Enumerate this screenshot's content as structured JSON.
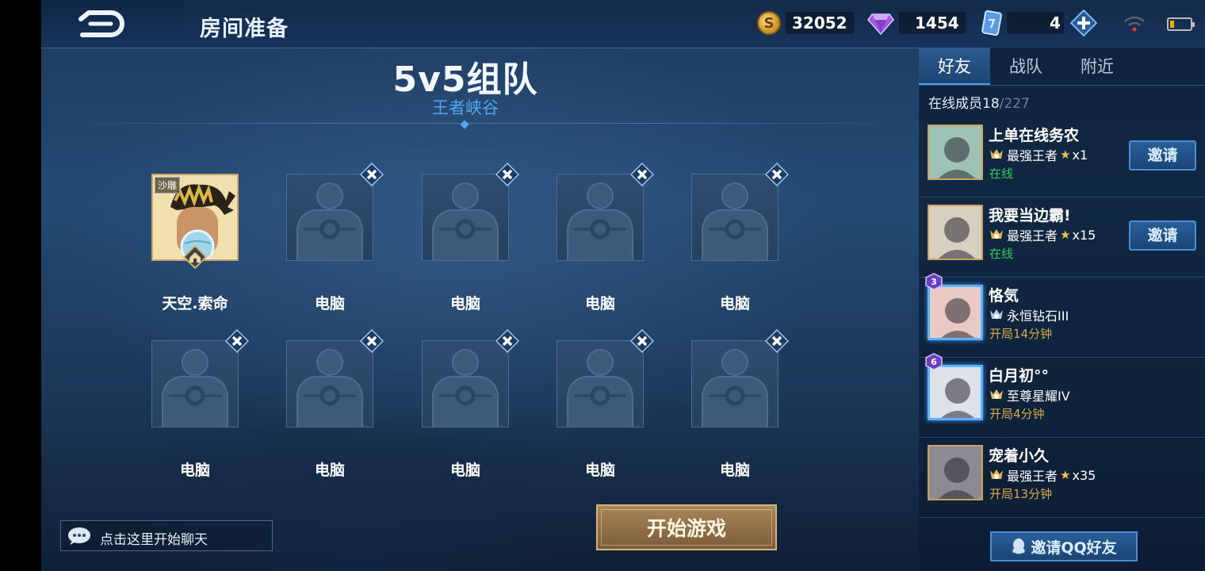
{
  "header": {
    "title": "房间准备",
    "back_icon": "back-arrow-icon",
    "gold": "32052",
    "diamonds": "1454",
    "cards": "4"
  },
  "mode": {
    "title": "5v5组队",
    "map": "王者峡谷"
  },
  "team_top": [
    {
      "name": "天空.索命",
      "tag": "沙雕",
      "is_player": true
    },
    {
      "name": "电脑",
      "is_player": false
    },
    {
      "name": "电脑",
      "is_player": false
    },
    {
      "name": "电脑",
      "is_player": false
    },
    {
      "name": "电脑",
      "is_player": false
    }
  ],
  "team_bottom": [
    {
      "name": "电脑"
    },
    {
      "name": "电脑"
    },
    {
      "name": "电脑"
    },
    {
      "name": "电脑"
    },
    {
      "name": "电脑"
    }
  ],
  "start_button": "开始游戏",
  "chat_placeholder": "点击这里开始聊天",
  "panel": {
    "tabs": [
      "好友",
      "战队",
      "附近"
    ],
    "active_tab": "好友",
    "online_label": "在线成员",
    "online": "18",
    "total": "/227",
    "friends": [
      {
        "name": "上单在线务农",
        "rank": "最强王者",
        "stars": "x1",
        "status": "在线",
        "status_type": "online",
        "invite": "邀请"
      },
      {
        "name": "我要当边霸!",
        "rank": "最强王者",
        "stars": "x15",
        "status": "在线",
        "status_type": "online",
        "invite": "邀请"
      },
      {
        "name": "恪気",
        "rank": "永恒钻石III",
        "stars": "",
        "status": "开局14分钟",
        "status_type": "playing",
        "level": "3"
      },
      {
        "name": "白月初°°",
        "rank": "至尊星耀IV",
        "stars": "",
        "status": "开局4分钟",
        "status_type": "playing",
        "level": "6"
      },
      {
        "name": "宠着小久",
        "rank": "最强王者",
        "stars": "x35",
        "status": "开局13分钟",
        "status_type": "playing"
      }
    ],
    "invite_qq": "邀请QQ好友"
  },
  "colors": {
    "accent_blue": "#4fa7ee",
    "online_green": "#30d158",
    "playing_gold": "#d8a94a",
    "start_gold": "#a8865a"
  }
}
